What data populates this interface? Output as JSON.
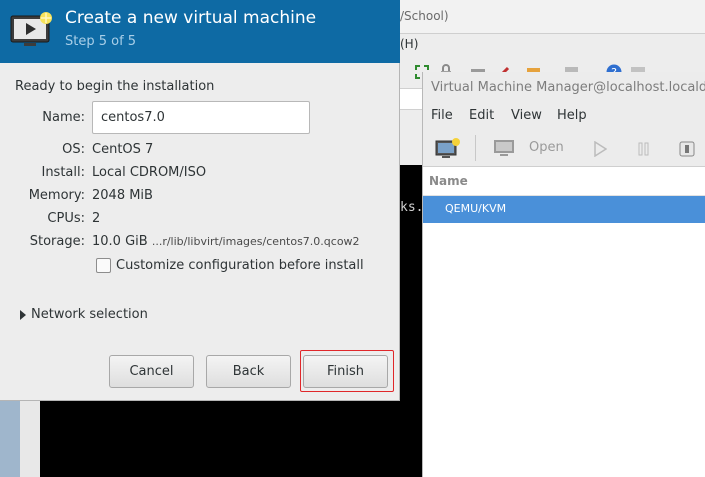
{
  "background_window": {
    "title_fragment": "/School)",
    "menu_fragment": "(H)"
  },
  "terminal": {
    "text_fragment": "ks."
  },
  "vmm": {
    "title": "Virtual Machine Manager@localhost.localdoma",
    "menu": [
      "File",
      "Edit",
      "View",
      "Help"
    ],
    "toolbar": {
      "open_label": "Open"
    },
    "list_header": "Name",
    "connections": [
      "QEMU/KVM"
    ]
  },
  "dialog": {
    "title": "Create a new virtual machine",
    "step": "Step 5 of 5",
    "ready_label": "Ready to begin the installation",
    "name_label": "Name:",
    "name_value": "centos7.0",
    "os_label": "OS:",
    "os_value": "CentOS 7",
    "install_label": "Install:",
    "install_value": "Local CDROM/ISO",
    "memory_label": "Memory:",
    "memory_value": "2048 MiB",
    "cpus_label": "CPUs:",
    "cpus_value": "2",
    "storage_label": "Storage:",
    "storage_size": "10.0 GiB",
    "storage_path": "...r/lib/libvirt/images/centos7.0.qcow2",
    "customize_label": "Customize configuration before install",
    "customize_checked": false,
    "network_label": "Network selection",
    "buttons": {
      "cancel": "Cancel",
      "back": "Back",
      "finish": "Finish"
    }
  },
  "colors": {
    "header_blue": "#0e6aa4",
    "selection_blue": "#4a90d9",
    "highlight_red": "#e0272a"
  }
}
